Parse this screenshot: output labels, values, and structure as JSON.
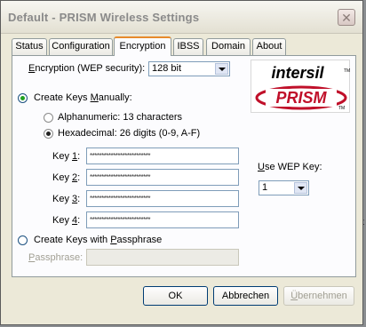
{
  "window": {
    "title": "Default - PRISM Wireless Settings"
  },
  "tabs": [
    {
      "label": "Status",
      "active": false
    },
    {
      "label": "Configuration",
      "active": false
    },
    {
      "label": "Encryption",
      "active": true
    },
    {
      "label": "IBSS",
      "active": false
    },
    {
      "label": "Domain",
      "active": false
    },
    {
      "label": "About",
      "active": false
    }
  ],
  "encryption": {
    "label_prefix": "E",
    "label_rest": "ncryption (WEP security):",
    "value": "128 bit"
  },
  "create_manual": {
    "label_prefix": "Create Keys ",
    "label_underline": "M",
    "label_rest": "anually:",
    "checked": true
  },
  "alphanumeric": {
    "label": "Alphanumeric: 13 characters",
    "checked": false
  },
  "hexadecimal": {
    "label": "Hexadecimal: 26 digits (0-9, A-F)",
    "checked": true
  },
  "keys": [
    {
      "label_prefix": "Key ",
      "label_underline": "1",
      "label_suffix": ":",
      "value": "**************************"
    },
    {
      "label_prefix": "Key ",
      "label_underline": "2",
      "label_suffix": ":",
      "value": "**************************"
    },
    {
      "label_prefix": "Key ",
      "label_underline": "3",
      "label_suffix": ":",
      "value": "**************************"
    },
    {
      "label_prefix": "Key ",
      "label_underline": "4",
      "label_suffix": ":",
      "value": "**************************"
    }
  ],
  "use_wep_key": {
    "label_underline": "U",
    "label_rest": "se WEP Key:",
    "value": "1"
  },
  "passphrase_option": {
    "label_prefix": "Create Keys with ",
    "label_underline": "P",
    "label_rest": "assphrase",
    "checked": false
  },
  "passphrase": {
    "label_underline": "P",
    "label_rest": "assphrase:",
    "value": ""
  },
  "logo": {
    "brand_top": "intersil",
    "brand_bottom": "PRISM",
    "tm": "TM",
    "accent": "#c0102a"
  },
  "buttons": {
    "ok": "OK",
    "cancel": "Abbrechen",
    "apply_underline": "Ü",
    "apply_rest": "bernehmen"
  },
  "background": {
    "right_glyph_1": "it",
    "right_glyph_2": "i"
  }
}
